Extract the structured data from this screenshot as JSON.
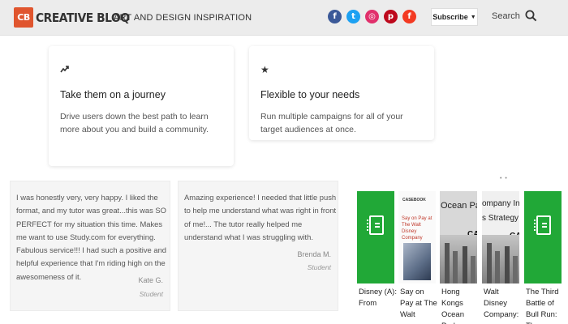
{
  "header": {
    "logo_badge": "CB",
    "logo_word": "CREATIVE BLOQ",
    "tagline": "ART AND DESIGN INSPIRATION",
    "social": [
      {
        "name": "facebook-icon",
        "glyph": "f"
      },
      {
        "name": "twitter-icon",
        "glyph": "t"
      },
      {
        "name": "instagram-icon",
        "glyph": "◎"
      },
      {
        "name": "pinterest-icon",
        "glyph": "p"
      },
      {
        "name": "flipboard-icon",
        "glyph": "f"
      }
    ],
    "subscribe_label": "Subscribe",
    "subscribe_caret": "▼",
    "search_label": "Search"
  },
  "features": [
    {
      "icon": "trend-up-icon",
      "icon_glyph": "⟋",
      "title": "Take them on a journey",
      "body": "Drive users down the best path to learn more about you and build a community."
    },
    {
      "icon": "star-icon",
      "icon_glyph": "★",
      "title": "Flexible to your needs",
      "body": "Run multiple campaigns for all of your target audiences at once."
    }
  ],
  "testimonials": [
    {
      "quote": "I was honestly very, very happy. I liked the format, and my tutor was great...this was SO PERFECT for my situation this time. Makes me want to use Study.com for everything. Fabulous service!!! I had such a positive and helpful experience that I'm riding high on the awesomeness of it.",
      "name": "Kate G.",
      "role": "Student"
    },
    {
      "quote": "Amazing experience! I needed that little push to help me understand what was right in front of me!... The tutor really helped me understand what I was struggling with.",
      "name": "Brenda M.",
      "role": "Student"
    }
  ],
  "shelf": {
    "dots": "• •",
    "books": [
      {
        "title": "Disney (A): From",
        "cover": "green"
      },
      {
        "title": "Say on Pay at The Walt",
        "cover": "white",
        "cover_label": "CASEBOOK",
        "cover_text": "Say on Pay at The Walt Disney Company"
      },
      {
        "title": "Hong Kongs Ocean Park",
        "cover": "grey",
        "cover_text": "Ocean Park Tai",
        "cover_ca": "CA"
      },
      {
        "title": "Walt Disney Company:",
        "cover": "white",
        "cover_text": "ompany Invest",
        "cover_sub": "s Strategy",
        "cover_ca": "CA"
      },
      {
        "title": "The Third Battle of Bull Run: The",
        "cover": "green"
      }
    ]
  }
}
